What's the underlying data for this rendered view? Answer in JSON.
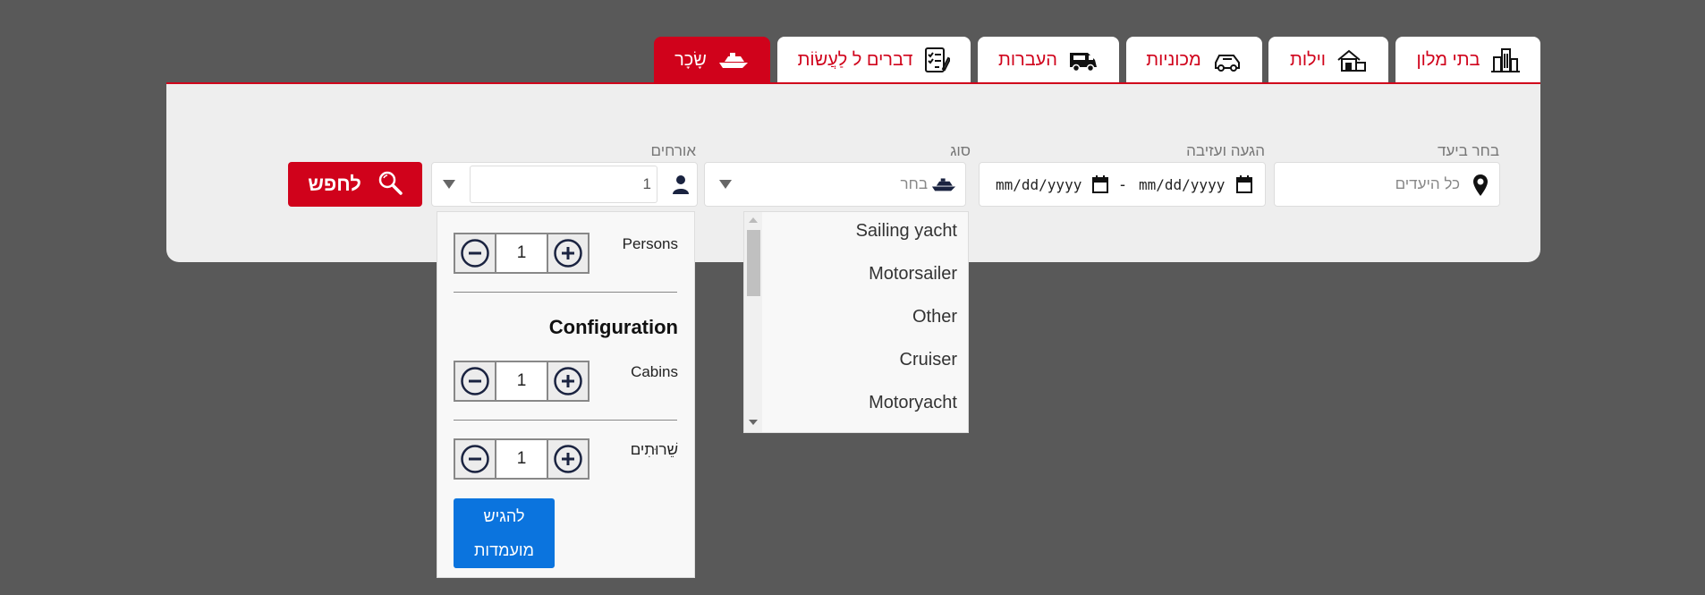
{
  "tabs": [
    {
      "label": "בתי מלון",
      "icon": "buildings-icon"
    },
    {
      "label": "וילות",
      "icon": "villa-icon"
    },
    {
      "label": "מכוניות",
      "icon": "car-icon"
    },
    {
      "label": "העברות",
      "icon": "van-icon"
    },
    {
      "label": "דברים ל לַעֲשׂוֹת",
      "icon": "checklist-icon"
    },
    {
      "label": "שָׂכָר",
      "icon": "yacht-icon",
      "active": true
    }
  ],
  "search": {
    "destination_label": "בחר ביעד",
    "destination_placeholder": "כל היעדים",
    "dates_label": "הגעה ועזיבה",
    "date_from": "mm/dd/yyyy",
    "date_to": "mm/dd/yyyy",
    "date_separator": "-",
    "type_label": "סוג",
    "type_placeholder": "בחר",
    "guests_label": "אורחים",
    "guests_value": "1",
    "search_button": "לחפש"
  },
  "guests_dropdown": {
    "persons_label": "Persons",
    "persons_value": "1",
    "configuration_title": "Configuration",
    "cabins_label": "Cabins",
    "cabins_value": "1",
    "toilets_label": "שֵׁרוּתִים",
    "toilets_value": "1",
    "submit_line1": "להגיש",
    "submit_line2": "מועמדות"
  },
  "type_options": [
    "Sailing yacht",
    "Motorsailer",
    "Other",
    "Cruiser",
    "Motoryacht"
  ],
  "colors": {
    "accent": "#d0021b",
    "submit": "#0b74de",
    "background": "#595959",
    "panel": "#eeeeee"
  }
}
